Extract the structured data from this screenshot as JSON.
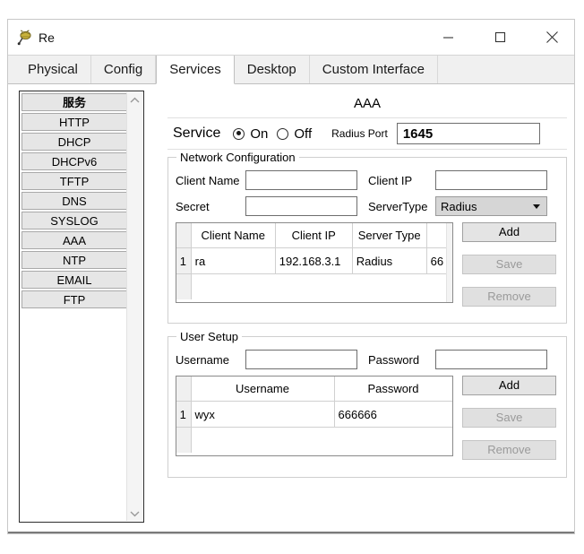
{
  "window": {
    "title": "Re",
    "icon": "router-icon",
    "controls": {
      "minimize": "minimize-icon",
      "maximize": "maximize-icon",
      "close": "close-icon"
    }
  },
  "tabs": [
    {
      "label": "Physical",
      "active": false
    },
    {
      "label": "Config",
      "active": false
    },
    {
      "label": "Services",
      "active": true
    },
    {
      "label": "Desktop",
      "active": false
    },
    {
      "label": "Custom Interface",
      "active": false
    }
  ],
  "sidebar": {
    "header": "服务",
    "items": [
      {
        "label": "HTTP"
      },
      {
        "label": "DHCP"
      },
      {
        "label": "DHCPv6"
      },
      {
        "label": "TFTP"
      },
      {
        "label": "DNS"
      },
      {
        "label": "SYSLOG"
      },
      {
        "label": "AAA"
      },
      {
        "label": "NTP"
      },
      {
        "label": "EMAIL"
      },
      {
        "label": "FTP"
      }
    ],
    "scroll_up": "chevron-up-icon",
    "scroll_down": "chevron-down-icon"
  },
  "panel": {
    "title": "AAA",
    "service": {
      "label": "Service",
      "on_label": "On",
      "off_label": "Off",
      "selected": "On",
      "radius_port_label": "Radius Port",
      "radius_port_value": "1645"
    },
    "network_configuration": {
      "legend": "Network Configuration",
      "client_name_label": "Client Name",
      "client_name_value": "",
      "client_ip_label": "Client IP",
      "client_ip_value": "",
      "secret_label": "Secret",
      "secret_value": "",
      "server_type_label": "ServerType",
      "server_type_value": "Radius",
      "table": {
        "columns": [
          "",
          "Client Name",
          "Client IP",
          "Server Type",
          ""
        ],
        "rows": [
          {
            "index": "1",
            "client_name": "ra",
            "client_ip": "192.168.3.1",
            "server_type": "Radius",
            "key": "66"
          }
        ]
      },
      "buttons": [
        {
          "label": "Add",
          "enabled": true
        },
        {
          "label": "Save",
          "enabled": false
        },
        {
          "label": "Remove",
          "enabled": false
        }
      ]
    },
    "user_setup": {
      "legend": "User Setup",
      "username_label": "Username",
      "username_value": "",
      "password_label": "Password",
      "password_value": "",
      "table": {
        "columns": [
          "",
          "Username",
          "Password"
        ],
        "rows": [
          {
            "index": "1",
            "username": "wyx",
            "password": "666666"
          }
        ]
      },
      "buttons": [
        {
          "label": "Add",
          "enabled": true
        },
        {
          "label": "Save",
          "enabled": false
        },
        {
          "label": "Remove",
          "enabled": false
        }
      ]
    }
  },
  "colors": {
    "window_bg": "#ffffff",
    "tabbar_bg": "#f0f0f0",
    "button_bg": "#e4e4e4",
    "disabled_text": "#9a9a9a",
    "border": "#cfcfcf"
  }
}
